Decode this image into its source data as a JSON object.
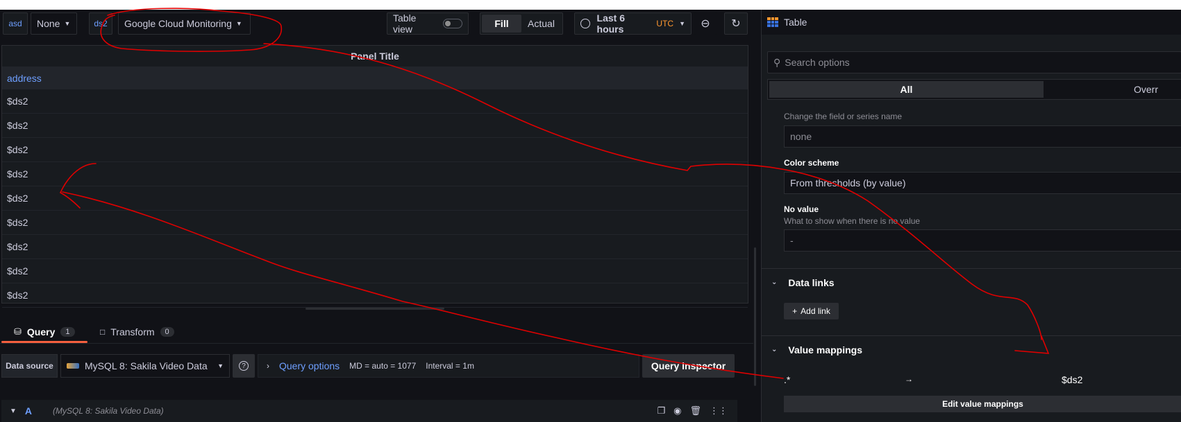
{
  "toolbar": {
    "var1_label": "asd",
    "var1_value": "None",
    "var2_label": "ds2",
    "var2_value": "Google Cloud Monitoring",
    "table_view_label": "Table view",
    "fill_label": "Fill",
    "actual_label": "Actual",
    "time_range": "Last 6 hours",
    "timezone": "UTC"
  },
  "panel": {
    "title": "Panel Title",
    "column_header": "address",
    "rows": [
      "$ds2",
      "$ds2",
      "$ds2",
      "$ds2",
      "$ds2",
      "$ds2",
      "$ds2",
      "$ds2",
      "$ds2"
    ]
  },
  "query_tabs": [
    {
      "label": "Query",
      "count": "1"
    },
    {
      "label": "Transform",
      "count": "0"
    }
  ],
  "query_bar": {
    "data_source_label": "Data source",
    "data_source_value": "MySQL 8: Sakila Video Data",
    "query_options_label": "Query options",
    "md_info": "MD = auto = 1077",
    "interval_info": "Interval = 1m",
    "inspector_label": "Query inspector"
  },
  "query_row": {
    "ref_id": "A",
    "datasource": "(MySQL 8: Sakila Video Data)"
  },
  "options": {
    "viz_name": "Table",
    "search_placeholder": "Search options",
    "tab_all": "All",
    "tab_overrides": "Overr",
    "display_name_desc": "Change the field or series name",
    "display_name_placeholder": "none",
    "color_scheme_label": "Color scheme",
    "color_scheme_value": "From thresholds (by value)",
    "no_value_label": "No value",
    "no_value_desc": "What to show when there is no value",
    "no_value_placeholder": "-",
    "data_links_label": "Data links",
    "add_link_label": "Add link",
    "value_mappings_label": "Value mappings",
    "mapping_from": ".*",
    "mapping_arrow": "→",
    "mapping_to": "$ds2",
    "edit_mappings_label": "Edit value mappings"
  },
  "colors": {
    "background": "#111217",
    "panel": "#181b1f",
    "accent_blue": "#6e9fff",
    "accent_orange": "#ff9830",
    "tab_underline": "#f55f3e",
    "annotation_red": "#e00000"
  }
}
